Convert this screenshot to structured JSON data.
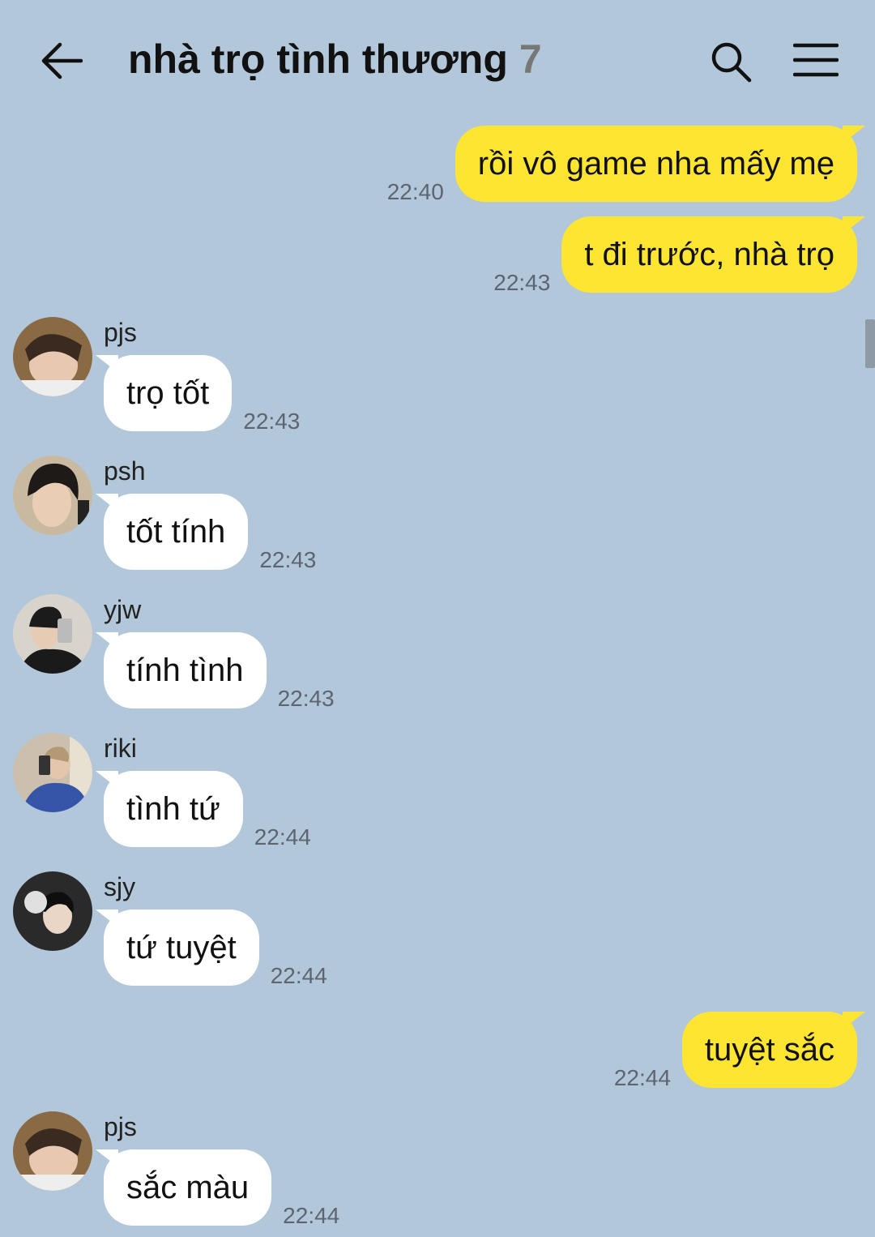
{
  "header": {
    "title": "nhà trọ tình thương",
    "member_count": "7"
  },
  "colors": {
    "background": "#b2c7da",
    "outgoing_bubble": "#fee532",
    "incoming_bubble": "#ffffff"
  },
  "messages": [
    {
      "dir": "out",
      "text": "rồi vô game nha mấy mẹ",
      "time": "22:40"
    },
    {
      "dir": "out",
      "text": "t đi trước, nhà trọ",
      "time": "22:43"
    },
    {
      "dir": "in",
      "sender": "pjs",
      "text": "trọ tốt",
      "time": "22:43"
    },
    {
      "dir": "in",
      "sender": "psh",
      "text": "tốt tính",
      "time": "22:43"
    },
    {
      "dir": "in",
      "sender": "yjw",
      "text": "tính tình",
      "time": "22:43"
    },
    {
      "dir": "in",
      "sender": "riki",
      "text": "tình tứ",
      "time": "22:44"
    },
    {
      "dir": "in",
      "sender": "sjy",
      "text": "tứ tuyệt",
      "time": "22:44"
    },
    {
      "dir": "out",
      "text": "tuyệt sắc",
      "time": "22:44"
    },
    {
      "dir": "in",
      "sender": "pjs",
      "text": "sắc màu",
      "time": "22:44"
    }
  ]
}
